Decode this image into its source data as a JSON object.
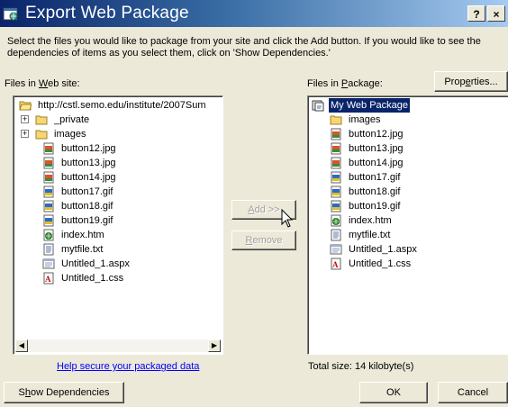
{
  "window": {
    "title": "Export Web Package",
    "help_label": "?",
    "close_label": "×"
  },
  "instructions": {
    "line1": "Select the files you would like to package from your site and click the Add button.  If you would like to see the",
    "line2": "dependencies of items as you select them, click on 'Show Dependencies.'"
  },
  "left": {
    "label_pre": "Files in ",
    "label_key": "W",
    "label_post": "eb site:",
    "root": "http://cstl.semo.edu/institute/2007Sum",
    "items": [
      {
        "name": "_private",
        "icon": "folder-icon",
        "expandable": true
      },
      {
        "name": "images",
        "icon": "folder-icon",
        "expandable": true
      },
      {
        "name": "button12.jpg",
        "icon": "jpg-file-icon"
      },
      {
        "name": "button13.jpg",
        "icon": "jpg-file-icon"
      },
      {
        "name": "button14.jpg",
        "icon": "jpg-file-icon"
      },
      {
        "name": "button17.gif",
        "icon": "gif-file-icon"
      },
      {
        "name": "button18.gif",
        "icon": "gif-file-icon"
      },
      {
        "name": "button19.gif",
        "icon": "gif-file-icon"
      },
      {
        "name": "index.htm",
        "icon": "htm-file-icon"
      },
      {
        "name": "mytfile.txt",
        "icon": "txt-file-icon"
      },
      {
        "name": "Untitled_1.aspx",
        "icon": "aspx-file-icon"
      },
      {
        "name": "Untitled_1.css",
        "icon": "css-file-icon"
      }
    ],
    "help_link": "Help secure your packaged data"
  },
  "middle": {
    "add_pre": "",
    "add_key": "A",
    "add_post": "dd >>",
    "remove_pre": "",
    "remove_key": "R",
    "remove_post": "emove"
  },
  "right": {
    "label_pre": "Files in ",
    "label_key": "P",
    "label_post": "ackage:",
    "properties_pre": "Prop",
    "properties_key": "e",
    "properties_post": "rties...",
    "root": "My Web Package",
    "items": [
      {
        "name": "images",
        "icon": "folder-icon"
      },
      {
        "name": "button12.jpg",
        "icon": "jpg-file-icon"
      },
      {
        "name": "button13.jpg",
        "icon": "jpg-file-icon"
      },
      {
        "name": "button14.jpg",
        "icon": "jpg-file-icon"
      },
      {
        "name": "button17.gif",
        "icon": "gif-file-icon"
      },
      {
        "name": "button18.gif",
        "icon": "gif-file-icon"
      },
      {
        "name": "button19.gif",
        "icon": "gif-file-icon"
      },
      {
        "name": "index.htm",
        "icon": "htm-file-icon"
      },
      {
        "name": "mytfile.txt",
        "icon": "txt-file-icon"
      },
      {
        "name": "Untitled_1.aspx",
        "icon": "aspx-file-icon"
      },
      {
        "name": "Untitled_1.css",
        "icon": "css-file-icon"
      }
    ],
    "total": "Total size: 14 kilobyte(s)"
  },
  "footer": {
    "show_pre": "S",
    "show_key": "h",
    "show_post": "ow Dependencies",
    "ok": "OK",
    "cancel": "Cancel"
  },
  "colors": {
    "title_start": "#0a246a",
    "title_end": "#a6caf0",
    "selection": "#0a246a",
    "face": "#ece9d8",
    "link": "#0000ff"
  }
}
